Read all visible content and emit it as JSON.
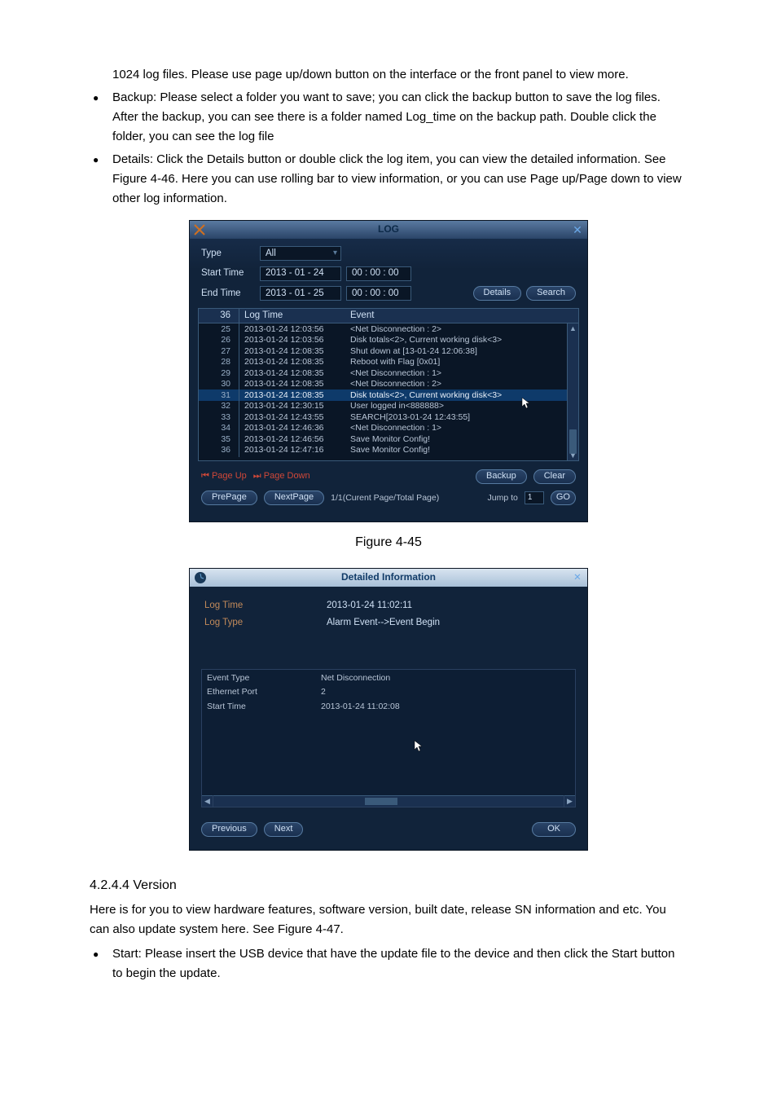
{
  "intro_cont": "1024 log files.  Please use page up/down button on the interface or the front panel to view more.",
  "bullets": [
    "Backup: Please select a folder you want to save; you can click the backup button to save the log files. After the backup, you can see there is a folder named Log_time on the backup path. Double click the folder, you can see the log file",
    "Details: Click the Details button or double click the log item, you can view the detailed information. See Figure 4-46. Here you can use rolling bar to view information, or you can use Page up/Page down to view other log information."
  ],
  "figure_445": "Figure 4-45",
  "log_dialog": {
    "title": "LOG",
    "labels": {
      "type": "Type",
      "start": "Start Time",
      "end": "End Time"
    },
    "type_value": "All",
    "start_date": "2013 - 01 - 24",
    "start_time": "00 : 00 : 00",
    "end_date": "2013 - 01 - 25",
    "end_time": "00 : 00 : 00",
    "btn_details": "Details",
    "btn_search": "Search",
    "head_count": "36",
    "head_logtime": "Log Time",
    "head_event": "Event",
    "rows": [
      {
        "n": "25",
        "t": "2013-01-24 12:03:56",
        "e": "<Net Disconnection : 2>"
      },
      {
        "n": "26",
        "t": "2013-01-24 12:03:56",
        "e": "Disk totals<2>, Current working disk<3>"
      },
      {
        "n": "27",
        "t": "2013-01-24 12:08:35",
        "e": "Shut down at [13-01-24 12:06:38]"
      },
      {
        "n": "28",
        "t": "2013-01-24 12:08:35",
        "e": "Reboot with Flag [0x01]"
      },
      {
        "n": "29",
        "t": "2013-01-24 12:08:35",
        "e": "<Net Disconnection : 1>"
      },
      {
        "n": "30",
        "t": "2013-01-24 12:08:35",
        "e": "<Net Disconnection : 2>"
      },
      {
        "n": "31",
        "t": "2013-01-24 12:08:35",
        "e": "Disk totals<2>, Current working disk<3>",
        "sel": true
      },
      {
        "n": "32",
        "t": "2013-01-24 12:30:15",
        "e": "User logged in<888888>"
      },
      {
        "n": "33",
        "t": "2013-01-24 12:43:55",
        "e": "SEARCH[2013-01-24 12:43:55]"
      },
      {
        "n": "34",
        "t": "2013-01-24 12:46:36",
        "e": "<Net Disconnection : 1>"
      },
      {
        "n": "35",
        "t": "2013-01-24 12:46:56",
        "e": "Save Monitor Config!"
      },
      {
        "n": "36",
        "t": "2013-01-24 12:47:16",
        "e": "Save Monitor Config!"
      }
    ],
    "page_up": "Page Up",
    "page_down": "Page Down",
    "backup": "Backup",
    "clear": "Clear",
    "prepage": "PrePage",
    "nextpage": "NextPage",
    "page_info": "1/1(Curent Page/Total Page)",
    "jump_to": "Jump to",
    "jump_val": "1",
    "go": "GO"
  },
  "detail_dialog": {
    "title": "Detailed Information",
    "log_time_label": "Log Time",
    "log_time_val": "2013-01-24 11:02:11",
    "log_type_label": "Log Type",
    "log_type_val": "Alarm Event-->Event Begin",
    "event_type_label": "Event Type",
    "event_type_val": "Net Disconnection",
    "eth_label": "Ethernet Port",
    "eth_val": "2",
    "start_label": "Start Time",
    "start_val": "2013-01-24 11:02:08",
    "previous": "Previous",
    "next": "Next",
    "ok": "OK"
  },
  "section": {
    "num": "4.2.4.4  Version",
    "p1": "Here is for you to view hardware features, software version, built date, release SN information and etc. You can also update system here. See Figure 4-47.",
    "b1": "Start: Please insert the USB device that have the update file to the device and then click the Start button to begin the update."
  }
}
